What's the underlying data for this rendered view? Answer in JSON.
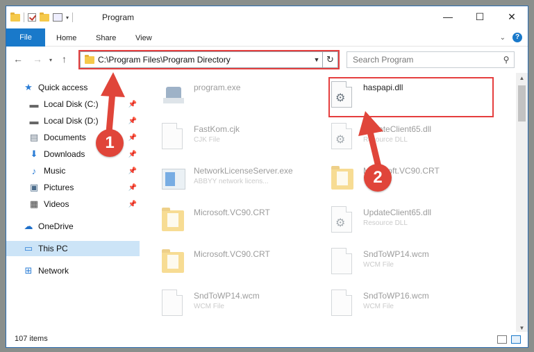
{
  "window": {
    "title": "Program",
    "controls": {
      "minimize": "—",
      "maximize": "☐",
      "close": "✕"
    }
  },
  "ribbon": {
    "tabs": [
      "File",
      "Home",
      "Share",
      "View"
    ]
  },
  "navigation": {
    "address": "C:\\Program Files\\Program Directory",
    "search_placeholder": "Search Program"
  },
  "sidebar": {
    "items": [
      {
        "label": "Quick access",
        "icon": "star-icon"
      },
      {
        "label": "Local Disk (C:)",
        "icon": "drive-icon",
        "pinned": true
      },
      {
        "label": "Local Disk (D:)",
        "icon": "drive-icon",
        "pinned": true
      },
      {
        "label": "Documents",
        "icon": "documents-icon",
        "pinned": true
      },
      {
        "label": "Downloads",
        "icon": "download-icon",
        "pinned": true
      },
      {
        "label": "Music",
        "icon": "music-icon",
        "pinned": true
      },
      {
        "label": "Pictures",
        "icon": "pictures-icon",
        "pinned": true
      },
      {
        "label": "Videos",
        "icon": "videos-icon",
        "pinned": true
      },
      {
        "label": "OneDrive",
        "icon": "cloud-icon"
      },
      {
        "label": "This PC",
        "icon": "computer-icon",
        "selected": true
      },
      {
        "label": "Network",
        "icon": "network-icon"
      }
    ]
  },
  "files": [
    {
      "name": "program.exe",
      "type": "",
      "icon": "exe-icon"
    },
    {
      "name": "haspapi.dll",
      "type": "",
      "icon": "dll-file-icon"
    },
    {
      "name": "FastKom.cjk",
      "type": "CJK File",
      "icon": "file-icon"
    },
    {
      "name": "UpdateClient65.dll",
      "type": "Resource DLL",
      "icon": "dll-file-icon"
    },
    {
      "name": "NetworkLicenseServer.exe",
      "type": "ABBYY network licens...",
      "icon": "app-icon"
    },
    {
      "name": "Microsoft.VC90.CRT",
      "type": "",
      "icon": "folder-icon"
    },
    {
      "name": "Microsoft.VC90.CRT",
      "type": "",
      "icon": "folder-icon"
    },
    {
      "name": "UpdateClient65.dll",
      "type": "Resource DLL",
      "icon": "dll-file-icon"
    },
    {
      "name": "Microsoft.VC90.CRT",
      "type": "",
      "icon": "folder-icon"
    },
    {
      "name": "SndToWP14.wcm",
      "type": "WCM File",
      "icon": "file-icon"
    },
    {
      "name": "SndToWP14.wcm",
      "type": "WCM File",
      "icon": "file-icon"
    },
    {
      "name": "SndToWP16.wcm",
      "type": "WCM File",
      "icon": "file-icon"
    }
  ],
  "status": {
    "item_count": "107 items"
  },
  "annotations": {
    "step1": "1",
    "step2": "2",
    "color": "#e53e3e"
  },
  "colors": {
    "accent": "#1979ca",
    "selection": "#cce4f7"
  }
}
